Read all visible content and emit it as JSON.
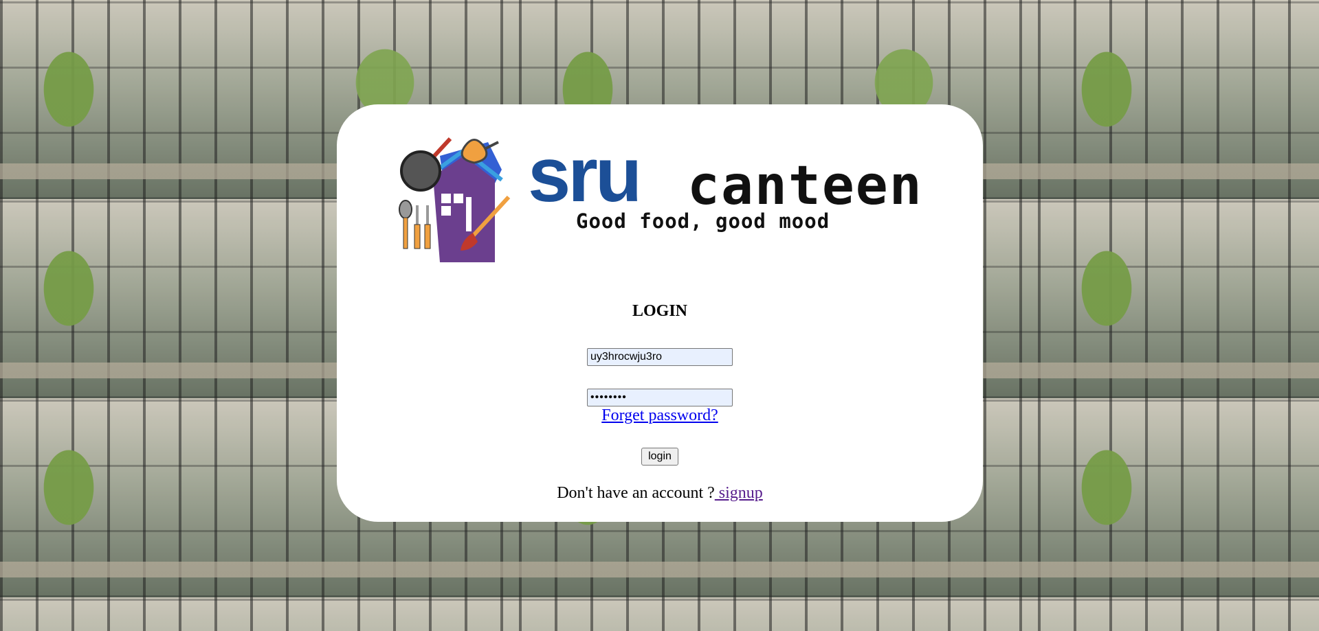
{
  "logo": {
    "brand_primary": "sru",
    "brand_secondary": "canteen",
    "tagline": "Good food, good mood",
    "colors": {
      "brand_blue": "#1c4f97",
      "house_purple": "#6b3f8e",
      "accent_orange": "#f0a040"
    }
  },
  "login": {
    "title": "LOGIN",
    "username_value": "uy3hrocwju3ro",
    "password_value": "••••••••",
    "forgot_link": "Forget password?",
    "button_label": "login",
    "no_account_text": "Don't have an account ?",
    "signup_link": " signup"
  }
}
